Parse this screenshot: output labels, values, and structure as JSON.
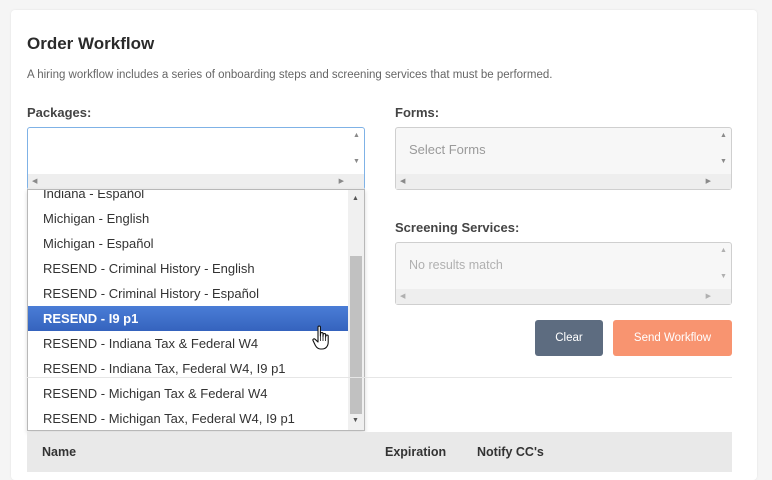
{
  "page": {
    "title": "Order Workflow",
    "description": "A hiring workflow includes a series of onboarding steps and screening services that must be performed."
  },
  "packages": {
    "label": "Packages:",
    "options": [
      "Indiana - Español",
      "Michigan - English",
      "Michigan - Español",
      "RESEND - Criminal History - English",
      "RESEND - Criminal History - Español",
      "RESEND - I9 p1",
      "RESEND - Indiana Tax & Federal W4",
      "RESEND - Indiana Tax, Federal W4, I9 p1",
      "RESEND - Michigan Tax & Federal W4",
      "RESEND - Michigan Tax, Federal W4, I9 p1"
    ],
    "selected_index": 5
  },
  "forms": {
    "label": "Forms:",
    "placeholder": "Select Forms"
  },
  "screening": {
    "label": "Screening Services:",
    "placeholder": "No results match"
  },
  "buttons": {
    "clear": "Clear",
    "send": "Send Workflow"
  },
  "table": {
    "headers": [
      "Name",
      "Expiration",
      "Notify CC's"
    ]
  },
  "colors": {
    "clear_button": "#5d6c80",
    "send_button": "#f89470",
    "selected_option": "#3f6fc9"
  }
}
